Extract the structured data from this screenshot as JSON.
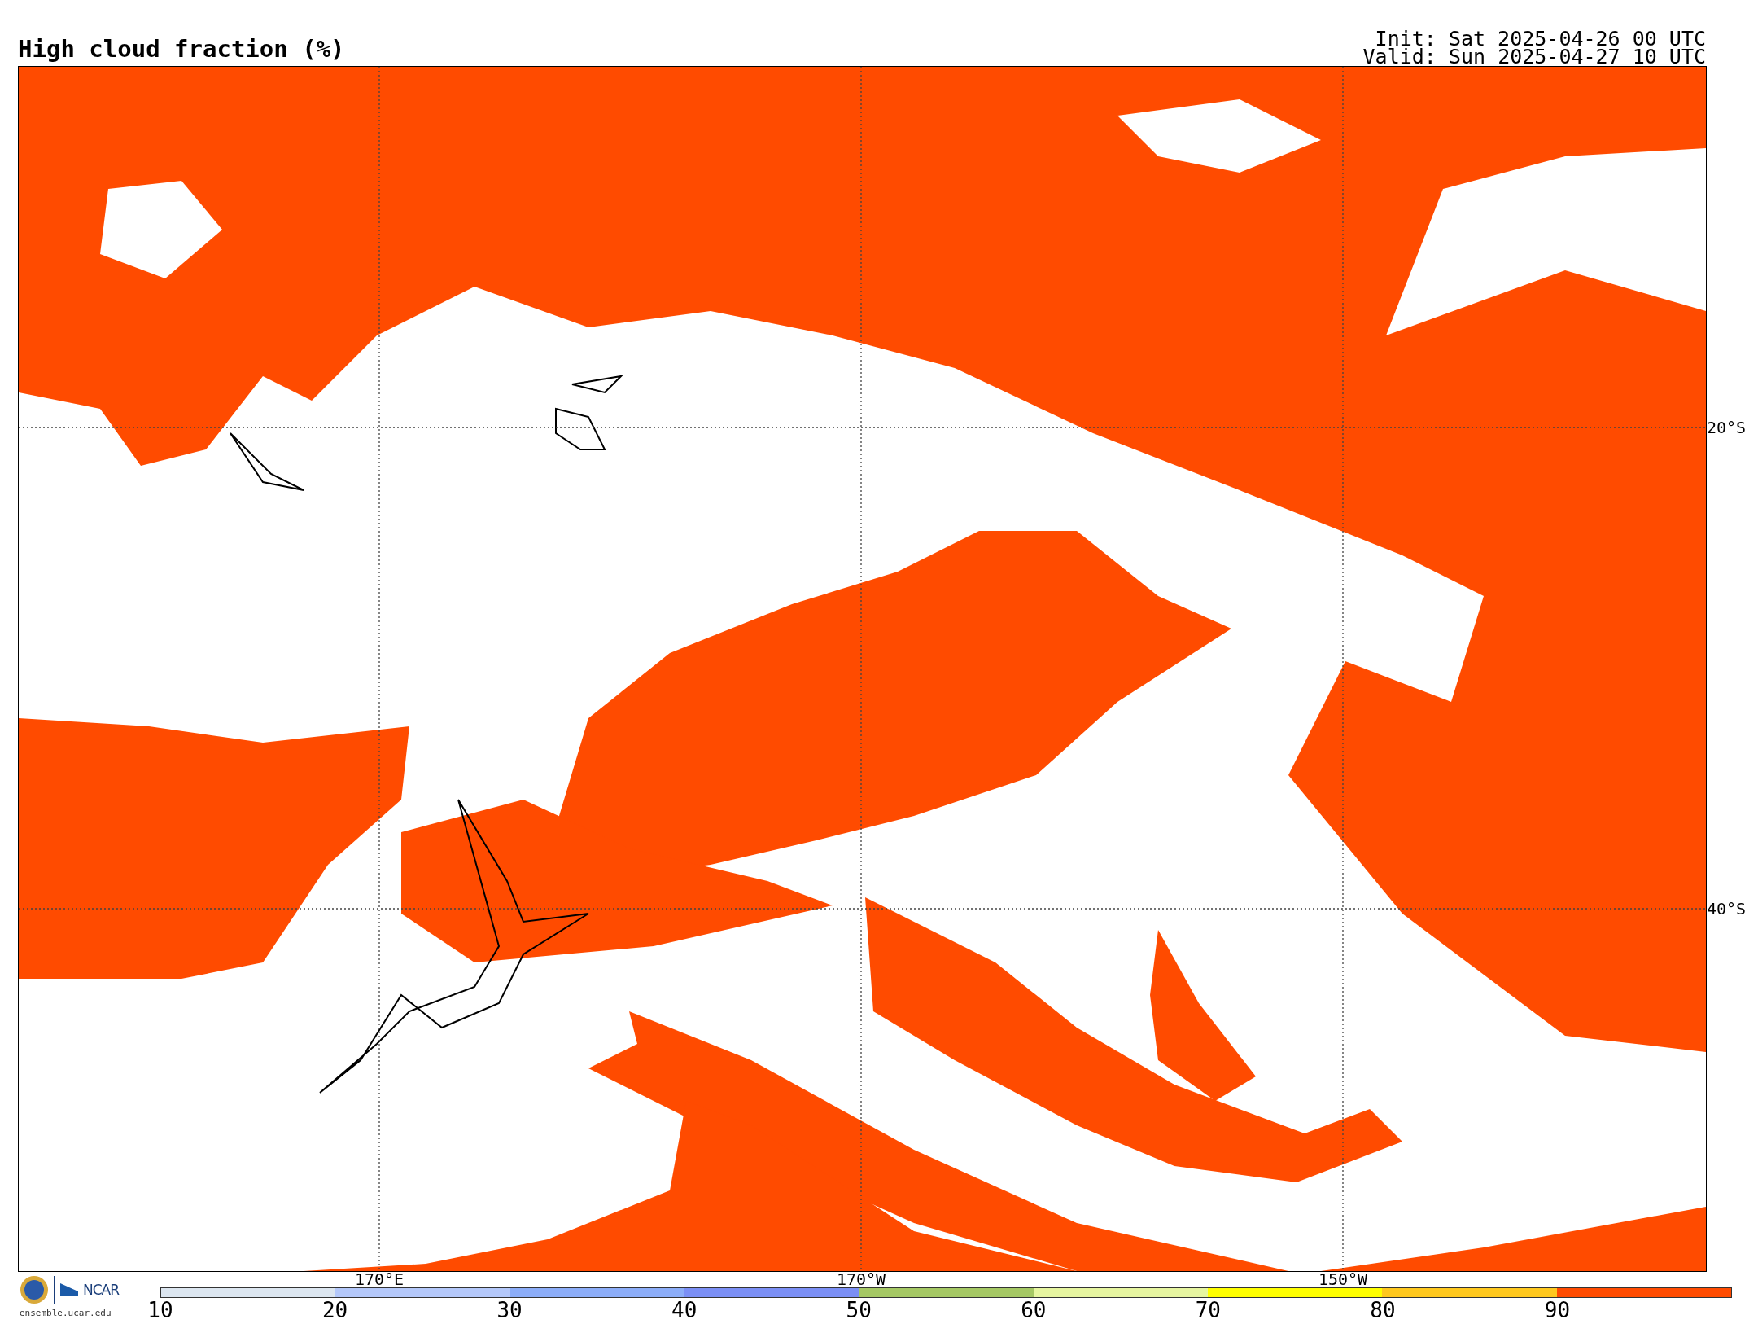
{
  "title": "High cloud fraction (%)",
  "run_info": [
    "Init: Sat 2025-04-26 00 UTC",
    "Valid: Sun 2025-04-27 10 UTC"
  ],
  "map": {
    "longitude_labels": [
      "170°E",
      "170°W",
      "150°W"
    ],
    "latitude_labels": [
      "20°S",
      "40°S"
    ]
  },
  "logo": {
    "text": "NCAR",
    "site": "ensemble.ucar.edu"
  },
  "colorbar": [
    {
      "label": "10",
      "color": "#dce6f0"
    },
    {
      "label": "20",
      "color": "#b4c8fa"
    },
    {
      "label": "30",
      "color": "#8cadf8"
    },
    {
      "label": "40",
      "color": "#7b8ff5"
    },
    {
      "label": "50",
      "color": "#a5c864"
    },
    {
      "label": "60",
      "color": "#e6f5a0"
    },
    {
      "label": "70",
      "color": "#ffff00"
    },
    {
      "label": "80",
      "color": "#ffc81e"
    },
    {
      "label": "90",
      "color": "#ff4b00"
    }
  ]
}
